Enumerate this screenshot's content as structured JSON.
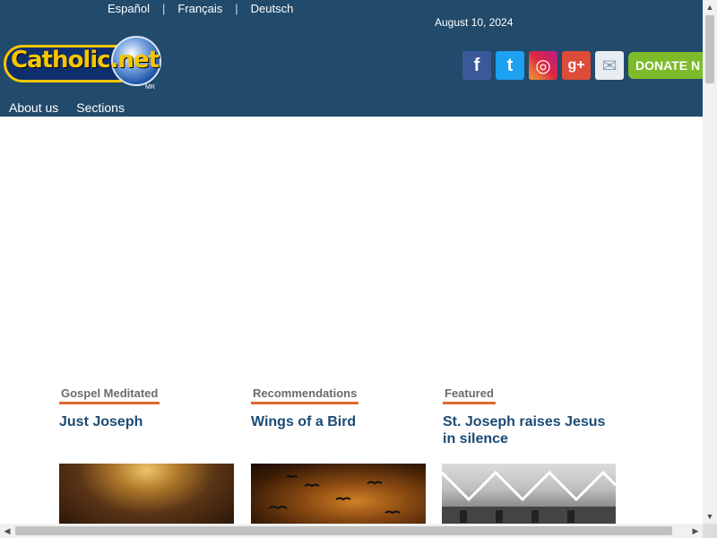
{
  "header": {
    "languages": [
      "Español",
      "Français",
      "Deutsch"
    ],
    "date": "August 10, 2024",
    "logo_text": "Catholic.net",
    "logo_mark": "MR",
    "social": [
      "facebook-icon",
      "twitter-icon",
      "instagram-icon",
      "google-plus-icon",
      "mail-icon"
    ],
    "social_glyphs": {
      "facebook": "f",
      "twitter": "t",
      "instagram": "◎",
      "google_plus": "g+",
      "mail": "✉"
    },
    "donate_label": "DONATE N",
    "nav": [
      "About us",
      "Sections"
    ]
  },
  "cards": [
    {
      "tag": "Gospel Meditated",
      "title": "Just Joseph"
    },
    {
      "tag": "Recommendations",
      "title": "Wings of a Bird"
    },
    {
      "tag": "Featured",
      "title": "St. Joseph raises Jesus in silence"
    }
  ],
  "colors": {
    "header_bg": "#214a6b",
    "accent_orange": "#e06a2a",
    "title_blue": "#1b4b75",
    "donate_green": "#7dbb2a"
  },
  "scrollbars": {
    "up": "▲",
    "down": "▼",
    "left": "◀",
    "right": "▶"
  }
}
